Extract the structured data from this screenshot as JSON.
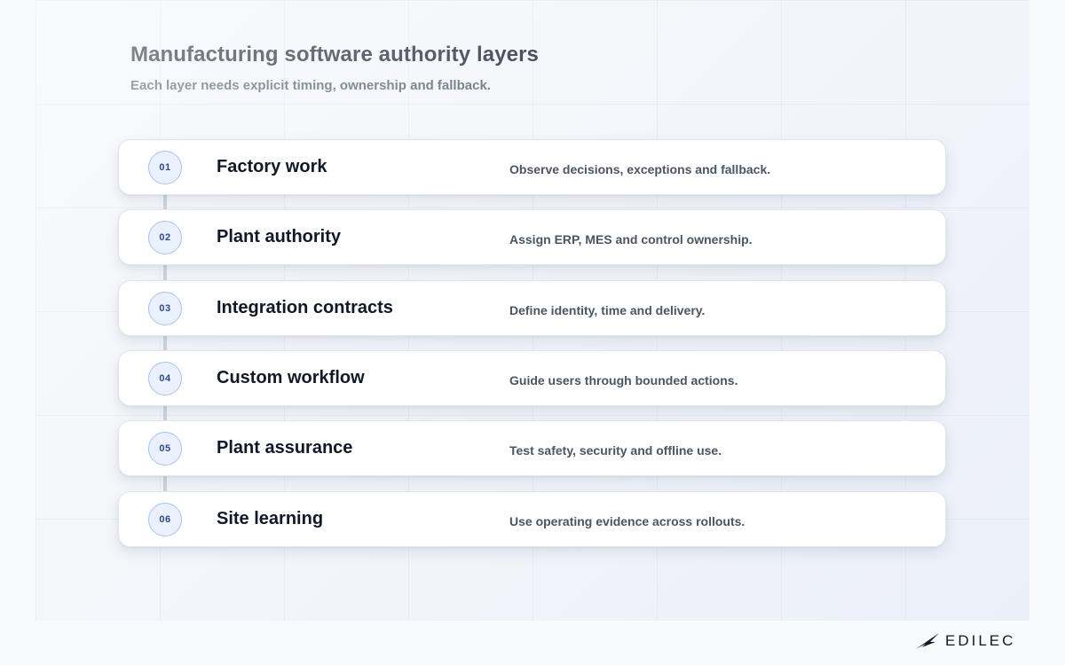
{
  "header": {
    "title": "Manufacturing software authority layers",
    "subtitle": "Each layer needs explicit timing, ownership and fallback."
  },
  "layers": [
    {
      "number": "01",
      "name": "Factory work",
      "description": "Observe decisions, exceptions and fallback."
    },
    {
      "number": "02",
      "name": "Plant authority",
      "description": "Assign ERP, MES and control ownership."
    },
    {
      "number": "03",
      "name": "Integration contracts",
      "description": "Define identity, time and delivery."
    },
    {
      "number": "04",
      "name": "Custom workflow",
      "description": "Guide users through bounded actions."
    },
    {
      "number": "05",
      "name": "Plant assurance",
      "description": "Test safety, security and offline use."
    },
    {
      "number": "06",
      "name": "Site learning",
      "description": "Use operating evidence across rollouts."
    }
  ],
  "brand": {
    "logo_text": "EDILEC",
    "logo_icon": "bird-wing-icon",
    "color": "#111827"
  },
  "colors": {
    "badge_fill": "#eaf1fd",
    "badge_border": "#a9c2ee",
    "badge_text": "#2f4a86",
    "spine": "#cfd4dc"
  }
}
